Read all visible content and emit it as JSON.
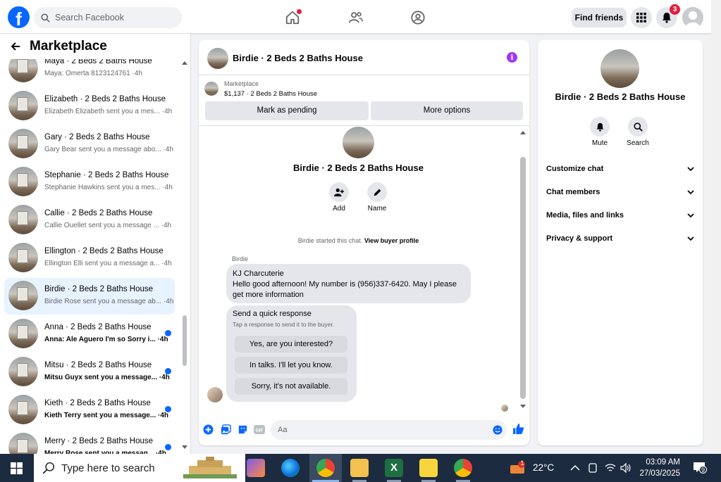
{
  "topbar": {
    "search_placeholder": "Search Facebook",
    "find_friends": "Find friends",
    "notification_count": "3"
  },
  "left": {
    "title": "Marketplace",
    "conversations": [
      {
        "name": "Maya · 2 Beds 2 Baths House",
        "preview": "Maya: Omerta 8123124761 ·4h",
        "unread": false
      },
      {
        "name": "Elizabeth · 2 Beds 2 Baths House",
        "preview": "Elizabeth Elizabeth sent you a mes... ·4h",
        "unread": false
      },
      {
        "name": "Gary · 2 Beds 2 Baths House",
        "preview": "Gary Bear sent you a message abo... ·4h",
        "unread": false
      },
      {
        "name": "Stephanie · 2 Beds 2 Baths House",
        "preview": "Stephanie Hawkins sent you a mes... ·4h",
        "unread": false
      },
      {
        "name": "Callie · 2 Beds 2 Baths House",
        "preview": "Callie Ouellet sent you a message ... ·4h",
        "unread": false
      },
      {
        "name": "Ellington · 2 Beds 2 Baths House",
        "preview": "Ellington Elli sent you a message a... ·4h",
        "unread": false
      },
      {
        "name": "Birdie · 2 Beds 2 Baths House",
        "preview": "Birdie Rose sent you a message ab... ·4h",
        "unread": false,
        "active": true
      },
      {
        "name": "Anna · 2 Beds 2 Baths House",
        "preview": "Anna: Ale Aguero I'm so Sorry i... ·4h",
        "unread": true
      },
      {
        "name": "Mitsu · 2 Beds 2 Baths House",
        "preview": "Mitsu Guyx sent you a message... ·4h",
        "unread": true
      },
      {
        "name": "Kieth · 2 Beds 2 Baths House",
        "preview": "Kieth Terry sent you a message... ·4h",
        "unread": true
      },
      {
        "name": "Merry · 2 Beds 2 Baths House",
        "preview": "Merry Rose sent you a messag... ·4h",
        "unread": true
      }
    ]
  },
  "chat": {
    "title": "Birdie · 2 Beds 2 Baths House",
    "marketplace_label": "Marketplace",
    "listing": "$1,137 · 2 Beds 2 Baths House",
    "mark_pending": "Mark as pending",
    "more_options": "More options",
    "add_label": "Add",
    "name_label": "Name",
    "started_text": "Birdie started this chat.",
    "view_profile": "View buyer profile",
    "sender": "Birdie",
    "message_line1": "KJ Charcuterie",
    "message_line2": "Hello good afternoon! My number is (956)337-6420. May I please get more information",
    "quick_title": "Send a quick response",
    "quick_sub": "Tap a response to send it to the buyer.",
    "quick_options": [
      "Yes, are you interested?",
      "In talks. I'll let you know.",
      "Sorry, it's not available."
    ],
    "input_placeholder": "Aa"
  },
  "details": {
    "title": "Birdie · 2 Beds 2 Baths House",
    "mute": "Mute",
    "search": "Search",
    "sections": [
      "Customize chat",
      "Chat members",
      "Media, files and links",
      "Privacy & support"
    ]
  },
  "taskbar": {
    "search_placeholder": "Type here to search",
    "temperature": "22°C",
    "weather_badge": "1",
    "time": "03:09 AM",
    "date": "27/03/2025",
    "notifications": "9"
  },
  "colors": {
    "brand": "#0866ff",
    "accent_purple": "#a033ff",
    "badge_red": "#e41e3f"
  }
}
